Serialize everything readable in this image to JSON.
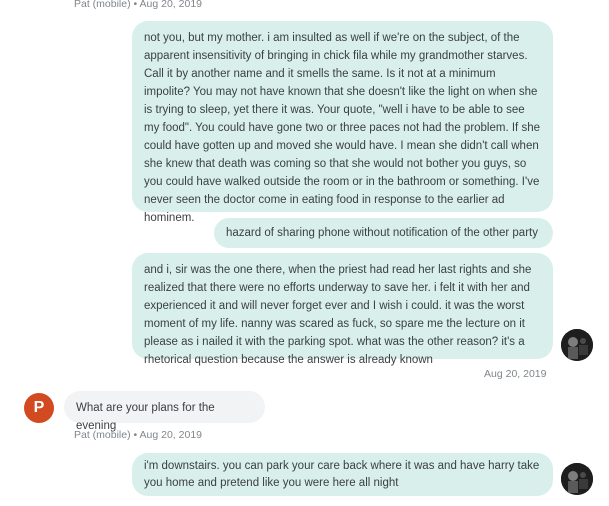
{
  "messages": [
    {
      "kind": "meta",
      "text": "Pat (mobile) • Aug 20, 2019"
    },
    {
      "kind": "out",
      "text": "not you, but my mother.  i am insulted as well if we're on the subject, of the apparent insensitivity of bringing in chick fila while my grandmother starves. Call it by another name and it smells the same.  Is it not at a minimum impolite?  You may not have known that she doesn't like the light on when she is trying to sleep, yet there it was.  Your quote, \"well i have to be able to see my food\".  You could have gone two or three paces not had the problem.  If she could have gotten up and moved she would have.  I mean she didn't call when she knew that death was coming so that she would not bother you guys,  so you could have walked outside the room or in the bathroom or something.  I've never seen the doctor come in eating food in response to the earlier ad hominem."
    },
    {
      "kind": "out",
      "text": "hazard of sharing phone without notification of the other party"
    },
    {
      "kind": "out",
      "text": "and i, sir was the one there, when the priest had read her last rights and she realized that there were no efforts underway to save her.  i felt it with her and experienced it and will never forget ever and I wish i could.  it was the worst moment of my life.  nanny was scared as fuck, so spare me the lecture on it please as i nailed it with the parking spot.  what was the other reason?  it's a rhetorical question because the answer is already known"
    },
    {
      "kind": "time",
      "text": "Aug 20, 2019"
    },
    {
      "kind": "in",
      "avatar": "P",
      "text": "What are your plans for the evening"
    },
    {
      "kind": "meta",
      "text": "Pat (mobile) • Aug 20, 2019"
    },
    {
      "kind": "out",
      "text": "i'm downstairs. you can park your care back where it was and have harry take you home and pretend like you were here all night"
    }
  ],
  "colors": {
    "outgoing_bubble": "#d8efec",
    "incoming_bubble": "#f1f3f4",
    "avatar_p": "#d24a1f",
    "meta_text": "#80868b"
  }
}
